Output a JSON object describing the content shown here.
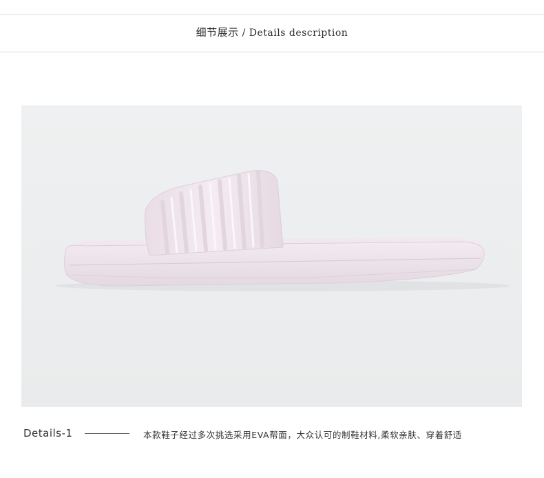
{
  "header": {
    "title_cn": "细节展示",
    "separator": " / ",
    "title_en": "Details description"
  },
  "photo": {
    "subject": "slipper-image",
    "background_color": "#eceeef",
    "product_color": "#efe4ec"
  },
  "caption": {
    "label": "Details-1",
    "text": "本款鞋子经过多次挑选采用EVA帮面，大众认可的制鞋材料,柔软亲肤、穿着舒适"
  }
}
